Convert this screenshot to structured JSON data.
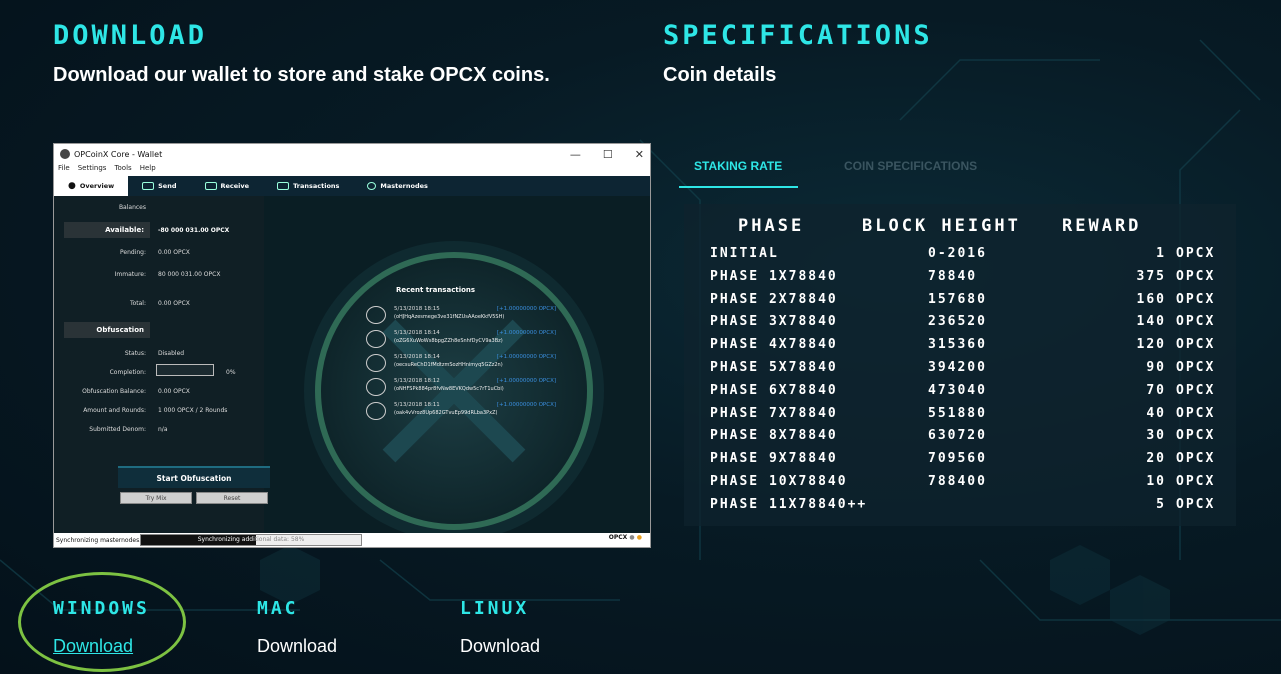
{
  "download": {
    "title": "DOWNLOAD",
    "subtitle": "Download our wallet to store and stake OPCX coins."
  },
  "specifications": {
    "title": "SPECIFICATIONS",
    "subtitle": "Coin details",
    "tabs": [
      {
        "label": "STAKING RATE",
        "active": true
      },
      {
        "label": "COIN SPECIFICATIONS",
        "active": false
      }
    ]
  },
  "staking_table": {
    "headers": [
      "PHASE",
      "BLOCK HEIGHT",
      "REWARD"
    ],
    "rows": [
      {
        "phase": "INITIAL",
        "block": "0-2016",
        "reward": "1",
        "unit": "OPCX"
      },
      {
        "phase": "PHASE 1X78840",
        "block": "78840",
        "reward": "375",
        "unit": "OPCX"
      },
      {
        "phase": "PHASE 2X78840",
        "block": "157680",
        "reward": "160",
        "unit": "OPCX"
      },
      {
        "phase": "PHASE 3X78840",
        "block": "236520",
        "reward": "140",
        "unit": "OPCX"
      },
      {
        "phase": "PHASE 4X78840",
        "block": "315360",
        "reward": "120",
        "unit": "OPCX"
      },
      {
        "phase": "PHASE 5X78840",
        "block": "394200",
        "reward": "90",
        "unit": "OPCX"
      },
      {
        "phase": "PHASE 6X78840",
        "block": "473040",
        "reward": "70",
        "unit": "OPCX"
      },
      {
        "phase": "PHASE 7X78840",
        "block": "551880",
        "reward": "40",
        "unit": "OPCX"
      },
      {
        "phase": "PHASE 8X78840",
        "block": "630720",
        "reward": "30",
        "unit": "OPCX"
      },
      {
        "phase": "PHASE 9X78840",
        "block": "709560",
        "reward": "20",
        "unit": "OPCX"
      },
      {
        "phase": "PHASE 10X78840",
        "block": "788400",
        "reward": "10",
        "unit": "OPCX"
      },
      {
        "phase": "PHASE 11X78840++",
        "block": "",
        "reward": "5",
        "unit": "OPCX"
      }
    ]
  },
  "wallet": {
    "window_title": "OPCoinX Core - Wallet",
    "window_controls": [
      "—",
      "☐",
      "✕"
    ],
    "menu": [
      "File",
      "Settings",
      "Tools",
      "Help"
    ],
    "tabs": [
      "Overview",
      "Send",
      "Receive",
      "Transactions",
      "Masternodes"
    ],
    "balances_label": "Balances",
    "available_label": "Available:",
    "available_value": "-80 000 031.00 OPCX",
    "pending_label": "Pending:",
    "pending_value": "0.00 OPCX",
    "immature_label": "Immature:",
    "immature_value": "80 000 031.00 OPCX",
    "total_label": "Total:",
    "total_value": "0.00 OPCX",
    "obfuscation_header": "Obfuscation",
    "status_label": "Status:",
    "status_value": "Disabled",
    "completion_label": "Completion:",
    "completion_value": "0%",
    "obf_balance_label": "Obfuscation Balance:",
    "obf_balance_value": "0.00 OPCX",
    "rounds_label": "Amount and Rounds:",
    "rounds_value": "1 000 OPCX / 2 Rounds",
    "denom_label": "Submitted Denom:",
    "denom_value": "n/a",
    "start_button": "Start Obfuscation",
    "try_mix_button": "Try Mix",
    "reset_button": "Reset",
    "recent_title": "Recent transactions",
    "transactions": [
      {
        "date": "5/13/2018 18:15",
        "amount": "[+1.00000000 OPCX]",
        "hash": "(oHJHqAzesmege3ve31fNZUsAAoeKkfV5SH)"
      },
      {
        "date": "5/13/2018 18:14",
        "amount": "[+1.00000000 OPCX]",
        "hash": "(oZG6XuWoWs8bpgZZh8eSnhfDyCV9a3Bz)"
      },
      {
        "date": "5/13/2018 18:14",
        "amount": "[+1.00000000 OPCX]",
        "hash": "(oecsuReChD1fMdtzmSozHHnimyq5GZz2n)"
      },
      {
        "date": "5/13/2018 18:12",
        "amount": "[+1.00000000 OPCX]",
        "hash": "(oNHFSPk884pr8fvNw8EVKQdw5c7rT1uCbi)"
      },
      {
        "date": "5/13/2018 18:11",
        "amount": "[+1.00000000 OPCX]",
        "hash": "(oak4vVroz8Up682GTvuEp99dRLba3PxZ)"
      }
    ],
    "status_left": "Synchronizing masternodes...",
    "sync_text_a": "Synchronizing addi",
    "sync_text_b": "tional data: 58%",
    "sync_progress": 0.58,
    "status_right": "OPCX"
  },
  "downloads": [
    {
      "os": "WINDOWS",
      "link": "Download",
      "highlighted": true
    },
    {
      "os": "MAC",
      "link": "Download",
      "highlighted": false
    },
    {
      "os": "LINUX",
      "link": "Download",
      "highlighted": false
    }
  ],
  "colors": {
    "accent": "#2ee6e6",
    "highlight": "#7dc242",
    "background": "#071a24"
  }
}
